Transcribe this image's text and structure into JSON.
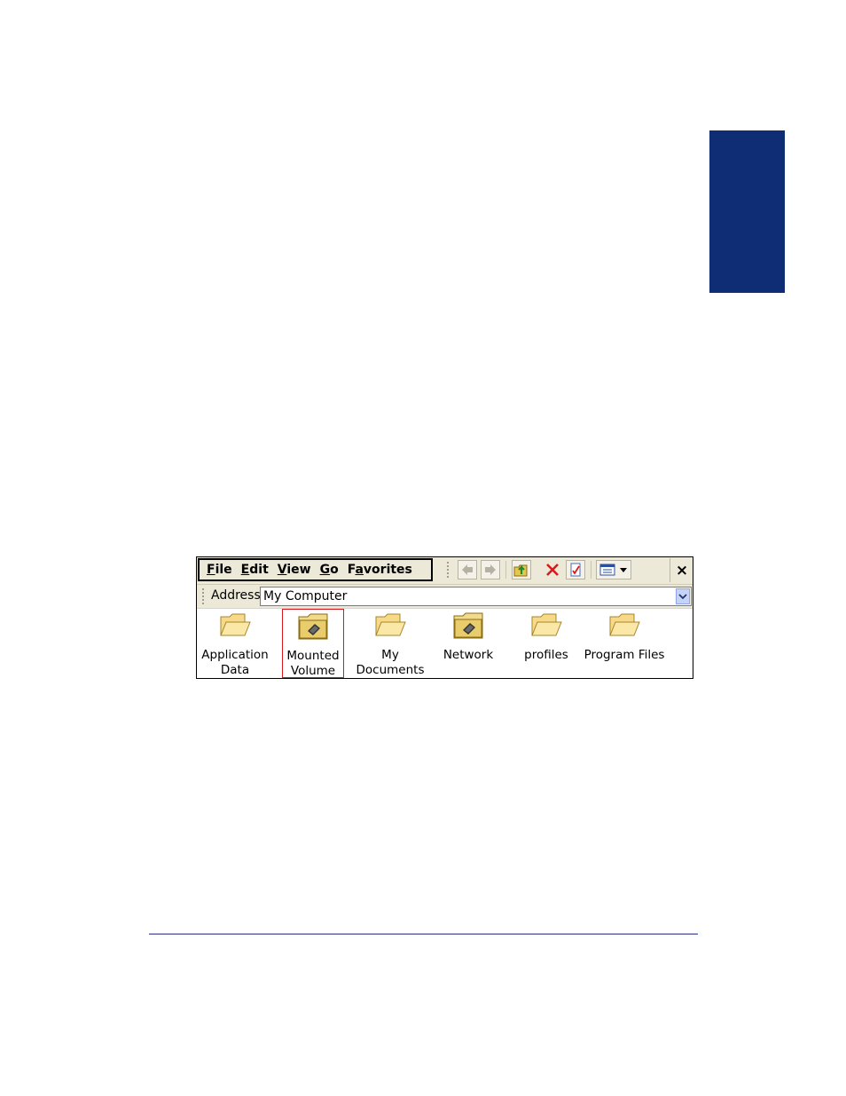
{
  "window": {
    "menu": [
      {
        "label_u": "F",
        "label_rest": "ile"
      },
      {
        "label_u": "E",
        "label_rest": "dit"
      },
      {
        "label_u": "V",
        "label_rest": "iew"
      },
      {
        "label_u": "G",
        "label_rest": "o"
      },
      {
        "label_pre": "F",
        "label_u": "a",
        "label_rest": "vorites"
      }
    ],
    "toolbar_icons": [
      "back-arrow-icon",
      "forward-arrow-icon",
      "up-folder-icon",
      "delete-icon",
      "properties-icon",
      "views-icon"
    ],
    "close_label": "×",
    "address": {
      "label": "Address",
      "value": "My Computer"
    },
    "items": [
      {
        "label": "Application\nData",
        "icon": "folder-icon",
        "selected": false
      },
      {
        "label": "Mounted\nVolume",
        "icon": "mounted-volume-folder-icon",
        "selected": true
      },
      {
        "label": "My\nDocuments",
        "icon": "folder-icon",
        "selected": false
      },
      {
        "label": "Network",
        "icon": "network-folder-icon",
        "selected": false
      },
      {
        "label": "profiles",
        "icon": "folder-icon",
        "selected": false
      },
      {
        "label": "Program Files",
        "icon": "folder-icon",
        "selected": false
      }
    ]
  },
  "colors": {
    "side_tab": "#0e2d74",
    "footer_rule": "#2a2f86",
    "selection": "#d8191d",
    "chrome": "#ece9d8"
  }
}
